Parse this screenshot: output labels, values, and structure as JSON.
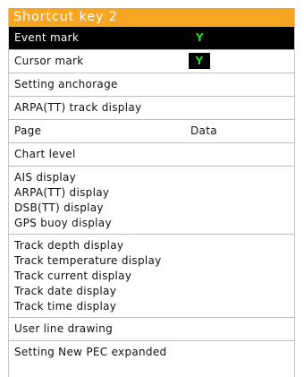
{
  "title": "Shortcut  key  2",
  "colors": {
    "title_bar": "#f6a623",
    "check": "#1ee01e",
    "selected_row": "#000000"
  },
  "items": {
    "event_mark": {
      "label": "Event  mark",
      "value": "Y"
    },
    "cursor_mark": {
      "label": "Cursor  mark",
      "value": "Y"
    },
    "setting_anchorage": {
      "label": "Setting  anchorage"
    },
    "arpa_track_display": {
      "label": "ARPA(TT)  track  display"
    },
    "page": {
      "label": "Page",
      "value": "Data"
    },
    "chart_level": {
      "label": "Chart  level"
    },
    "ais_display": {
      "label": "AIS  display"
    },
    "arpa_display": {
      "label": "ARPA(TT)  display"
    },
    "dsb_display": {
      "label": "DSB(TT)  display"
    },
    "gps_buoy_display": {
      "label": "GPS  buoy  display"
    },
    "track_depth_display": {
      "label": "Track  depth  display"
    },
    "track_temperature_display": {
      "label": "Track  temperature  display"
    },
    "track_current_display": {
      "label": "Track  current  display"
    },
    "track_date_display": {
      "label": "Track  date  display"
    },
    "track_time_display": {
      "label": "Track  time  display"
    },
    "user_line_drawing": {
      "label": "User  line  drawing"
    },
    "setting_new_pec_expanded": {
      "label": "Setting  New  PEC  expanded"
    }
  }
}
